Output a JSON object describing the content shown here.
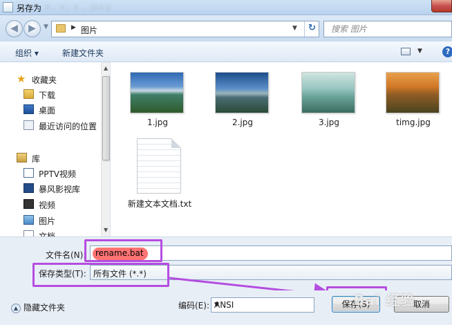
{
  "window": {
    "title": "另存为",
    "blurred_title": "×, ×, × , jpeg"
  },
  "address": {
    "path": "图片",
    "search_placeholder": "搜索 图片"
  },
  "toolbar": {
    "organize": "组织 ▾",
    "new_folder": "新建文件夹"
  },
  "sidebar": {
    "favorites": "收藏夹",
    "items": [
      {
        "label": "下载",
        "icon": "download-folder-icon"
      },
      {
        "label": "桌面",
        "icon": "desktop-icon"
      },
      {
        "label": "最近访问的位置",
        "icon": "recent-places-icon"
      }
    ],
    "libraries": "库",
    "lib_items": [
      {
        "label": "PPTV视频",
        "icon": "pptv-icon"
      },
      {
        "label": "暴风影视库",
        "icon": "baofeng-icon"
      },
      {
        "label": "视频",
        "icon": "video-icon"
      },
      {
        "label": "图片",
        "icon": "pictures-icon"
      },
      {
        "label": "文档",
        "icon": "documents-icon"
      }
    ]
  },
  "files": [
    {
      "name": "1.jpg",
      "type": "image"
    },
    {
      "name": "2.jpg",
      "type": "image"
    },
    {
      "name": "3.jpg",
      "type": "image"
    },
    {
      "name": "timg.jpg",
      "type": "image"
    },
    {
      "name": "新建文本文档.txt",
      "type": "text"
    }
  ],
  "form": {
    "filename_label": "文件名(N):",
    "filename_value": "rename.bat",
    "filetype_label": "保存类型(T):",
    "filetype_value": "所有文件  (*.*)"
  },
  "bottom": {
    "hide_folders": "隐藏文件夹",
    "encoding_label": "编码(E):",
    "encoding_value": "ANSI",
    "save": "保存(S)",
    "cancel": "取消",
    "watermark": "Bai 经验"
  },
  "colors": {
    "annotation": "#b44de0",
    "filename_highlight": "#ff5a5a"
  }
}
